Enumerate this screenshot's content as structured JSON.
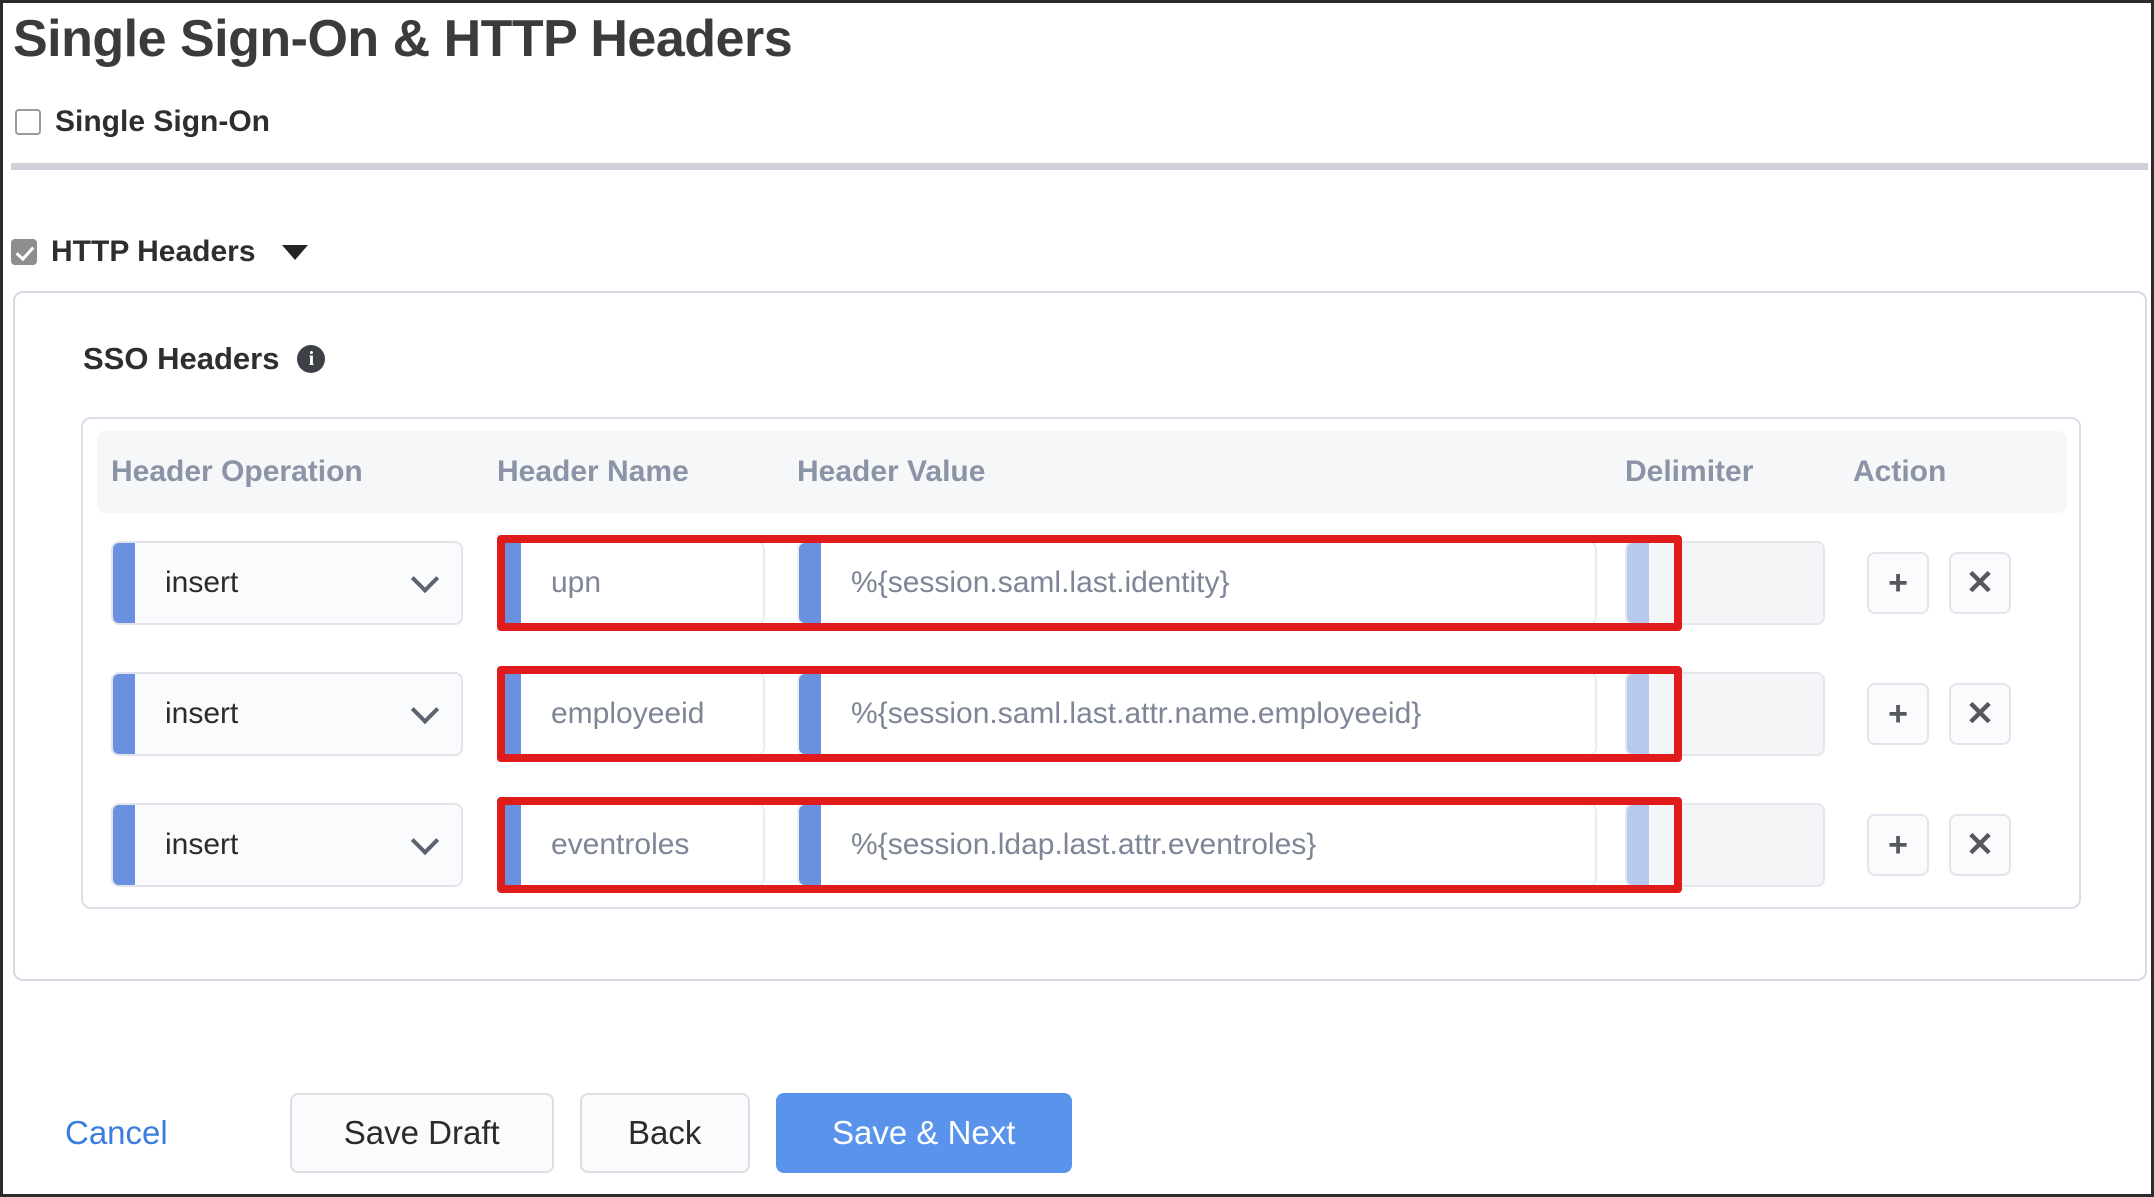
{
  "page": {
    "title": "Single Sign-On & HTTP Headers"
  },
  "sso_section": {
    "label": "Single Sign-On",
    "checked": false
  },
  "http_headers_section": {
    "label": "HTTP Headers",
    "checked": true,
    "caret_icon": "chevron-down-icon"
  },
  "panel": {
    "heading": "SSO Headers",
    "info_icon": "info-icon",
    "info_glyph": "i"
  },
  "table": {
    "columns": [
      "Header Operation",
      "Header Name",
      "Header Value",
      "Delimiter",
      "Action"
    ],
    "rows": [
      {
        "operation": "insert",
        "name": "upn",
        "value": "%{session.saml.last.identity}",
        "delimiter": "",
        "add_label": "+",
        "remove_label": "✕",
        "highlighted": true
      },
      {
        "operation": "insert",
        "name": "employeeid",
        "value": "%{session.saml.last.attr.name.employeeid}",
        "delimiter": "",
        "add_label": "+",
        "remove_label": "✕",
        "highlighted": true
      },
      {
        "operation": "insert",
        "name": "eventroles",
        "value": "%{session.ldap.last.attr.eventroles}",
        "delimiter": "",
        "add_label": "+",
        "remove_label": "✕",
        "highlighted": true
      }
    ]
  },
  "footer": {
    "cancel": "Cancel",
    "save_draft": "Save Draft",
    "back": "Back",
    "save_next": "Save & Next"
  },
  "colors": {
    "accent_blue": "#6a91e0",
    "primary_button": "#5a93ec",
    "link_blue": "#3b7ddd",
    "highlight_red": "#e01b1b",
    "header_text": "#8b93a6"
  }
}
